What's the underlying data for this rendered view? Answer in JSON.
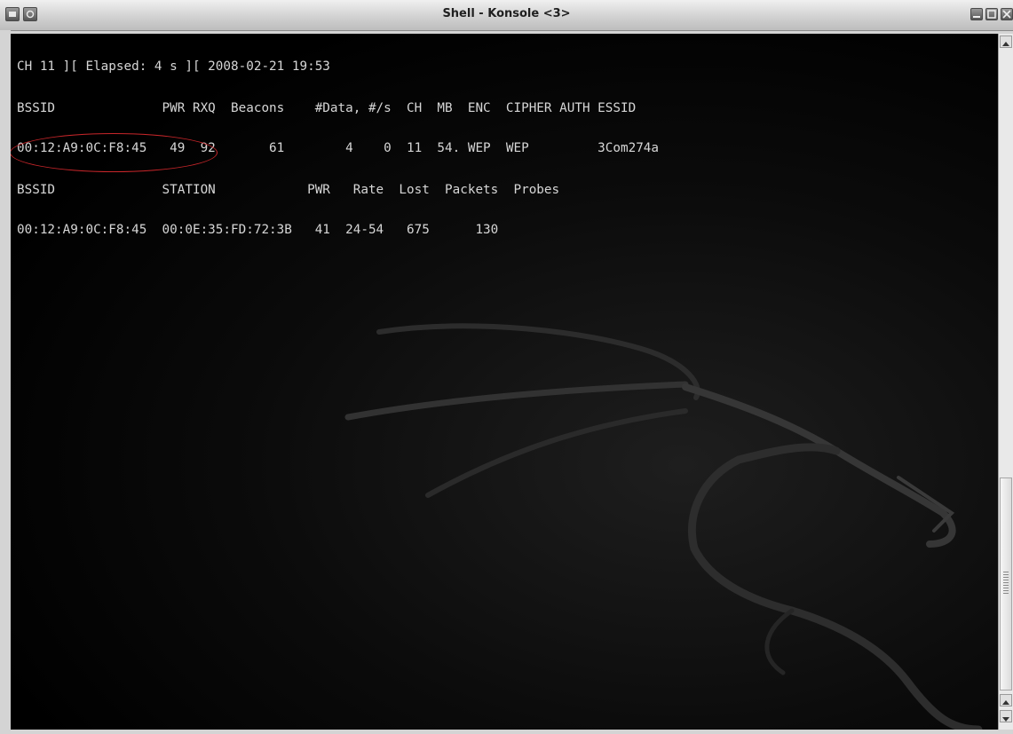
{
  "window": {
    "title": "Shell - Konsole <3>"
  },
  "terminal": {
    "lines": [
      "CH 11 ][ Elapsed: 4 s ][ 2008-02-21 19:53",
      "BSSID              PWR RXQ  Beacons    #Data, #/s  CH  MB  ENC  CIPHER AUTH ESSID",
      "00:12:A9:0C:F8:45   49  92       61        4    0  11  54. WEP  WEP         3Com274a",
      "BSSID              STATION            PWR   Rate  Lost  Packets  Probes",
      "00:12:A9:0C:F8:45  00:0E:35:FD:72:3B   41  24-54   675      130"
    ]
  },
  "colors": {
    "terminal_bg": "#000000",
    "terminal_text": "#d6d6d6",
    "highlight_ellipse": "#c8262a"
  },
  "icons": {
    "window_menu": "window-menu-icon",
    "sticky": "sticky-icon",
    "minimize": "minimize-icon",
    "maximize": "maximize-icon",
    "close": "close-icon",
    "background": "dragon-watermark-icon"
  }
}
